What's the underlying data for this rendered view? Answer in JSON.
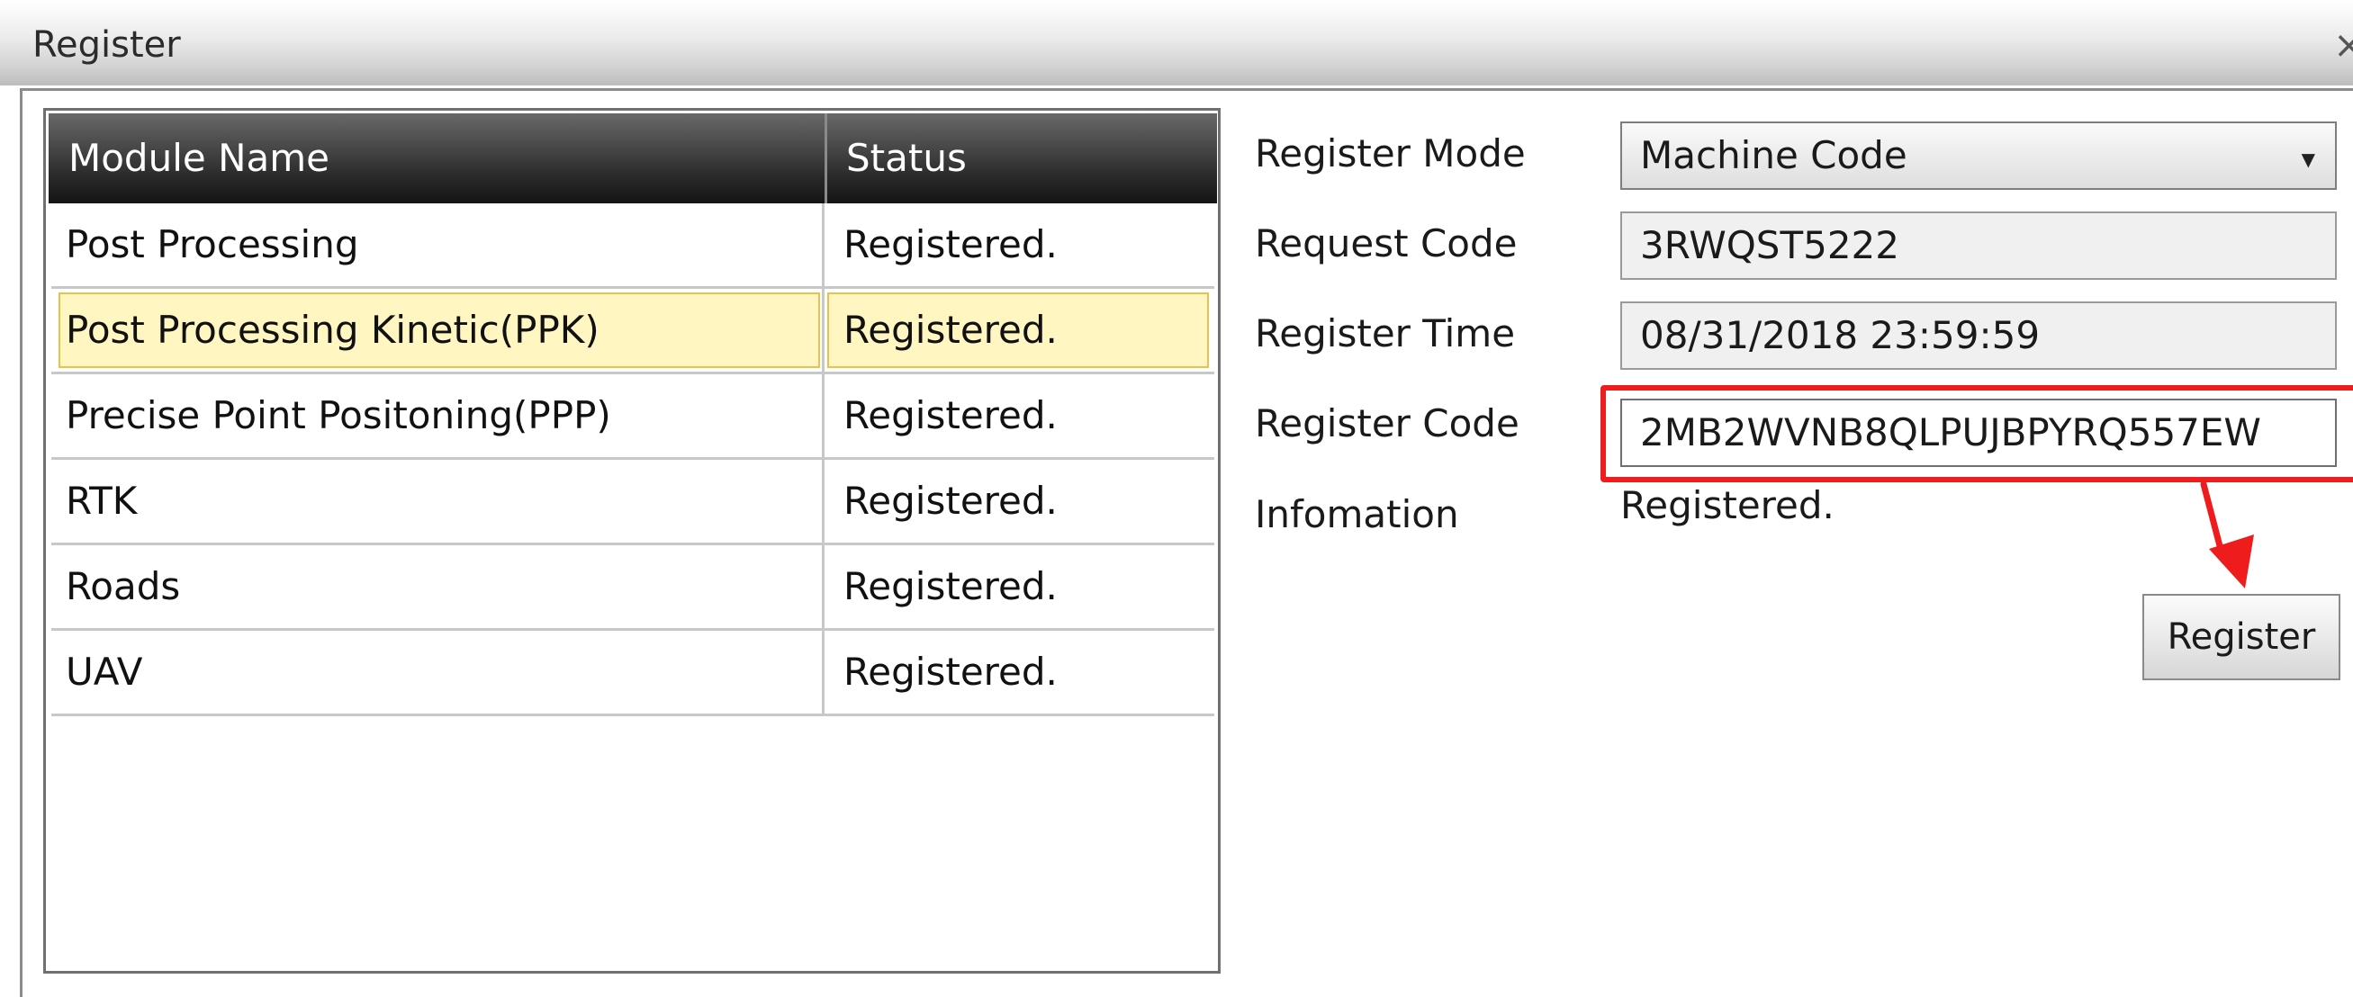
{
  "window": {
    "title": "Register",
    "close_glyph": "×"
  },
  "table": {
    "columns": [
      "Module Name",
      "Status"
    ],
    "rows": [
      {
        "name": "Post Processing",
        "status": "Registered."
      },
      {
        "name": "Post Processing Kinetic(PPK)",
        "status": "Registered.",
        "selected": true
      },
      {
        "name": "Precise Point Positoning(PPP)",
        "status": "Registered."
      },
      {
        "name": "RTK",
        "status": "Registered."
      },
      {
        "name": "Roads",
        "status": "Registered."
      },
      {
        "name": "UAV",
        "status": "Registered."
      }
    ]
  },
  "form": {
    "register_mode_label": "Register Mode",
    "register_mode_value": "Machine Code",
    "request_code_label": "Request Code",
    "request_code_value": "3RWQST5222",
    "register_time_label": "Register Time",
    "register_time_value": "08/31/2018 23:59:59",
    "register_code_label": "Register Code",
    "register_code_value": "2MB2WVNB8QLPUJBPYRQ557EW",
    "information_label": "Infomation",
    "information_value": "Registered.",
    "register_button_label": "Register"
  },
  "colors": {
    "annotation_red": "#ee1c1c",
    "selected_row_bg": "#fff6c2",
    "header_bg": "#2a2a2a"
  },
  "icons": {
    "dropdown": "chevron-down-icon",
    "close": "close-icon",
    "annotation": "arrow-annotation-icon"
  }
}
